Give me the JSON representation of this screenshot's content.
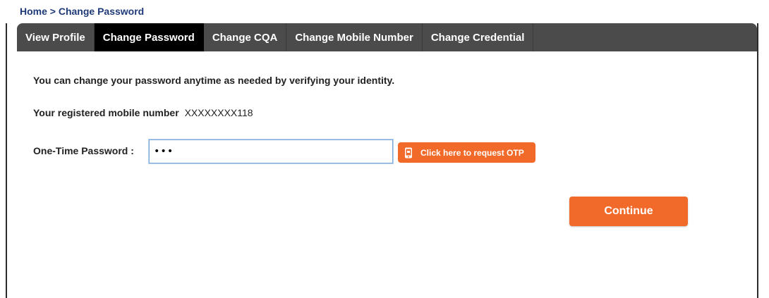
{
  "breadcrumb": "Home > Change Password",
  "tabs": [
    {
      "label": "View Profile",
      "active": false
    },
    {
      "label": "Change Password",
      "active": true
    },
    {
      "label": "Change CQA",
      "active": false
    },
    {
      "label": "Change Mobile Number",
      "active": false
    },
    {
      "label": "Change Credential",
      "active": false
    }
  ],
  "content": {
    "intro": "You can change your password anytime as needed by verifying your identity.",
    "mobile_label": "Your registered mobile number",
    "mobile_value": "XXXXXXXX118"
  },
  "otp": {
    "label": "One-Time Password :",
    "value": "•••",
    "request_button": "Click here to request OTP",
    "request_icon": "phone-icon"
  },
  "actions": {
    "continue_label": "Continue"
  },
  "colors": {
    "accent": "#f26a2a",
    "tabbar": "#4b4b4b",
    "tab_active": "#000000",
    "breadcrumb": "#1f3a78",
    "input_border": "#7aa7d9"
  }
}
